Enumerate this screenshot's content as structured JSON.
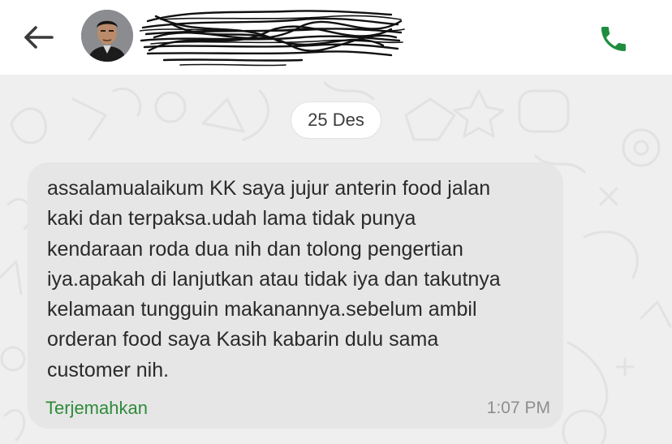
{
  "header": {
    "back_icon": "arrow-left-icon",
    "call_icon": "phone-icon",
    "call_color": "#1e8e3e",
    "contact_name_redacted": true
  },
  "chat": {
    "date_label": "25 Des",
    "messages": [
      {
        "lines": [
          "assalamualaikum KK saya jujur anterin food jalan",
          "kaki dan  terpaksa.udah lama tidak punya",
          "kendaraan roda dua nih dan tolong pengertian",
          "iya.apakah di lanjutkan atau tidak iya dan takutnya",
          "kelamaan tungguin makanannya.sebelum ambil",
          "orderan food saya Kasih kabarin dulu sama",
          "customer nih."
        ],
        "translate_label": "Terjemahkan",
        "time": "1:07 PM"
      }
    ]
  },
  "colors": {
    "link_green": "#2e8b3a",
    "bubble_bg": "#e6e6e6",
    "chat_bg": "#efefef"
  }
}
